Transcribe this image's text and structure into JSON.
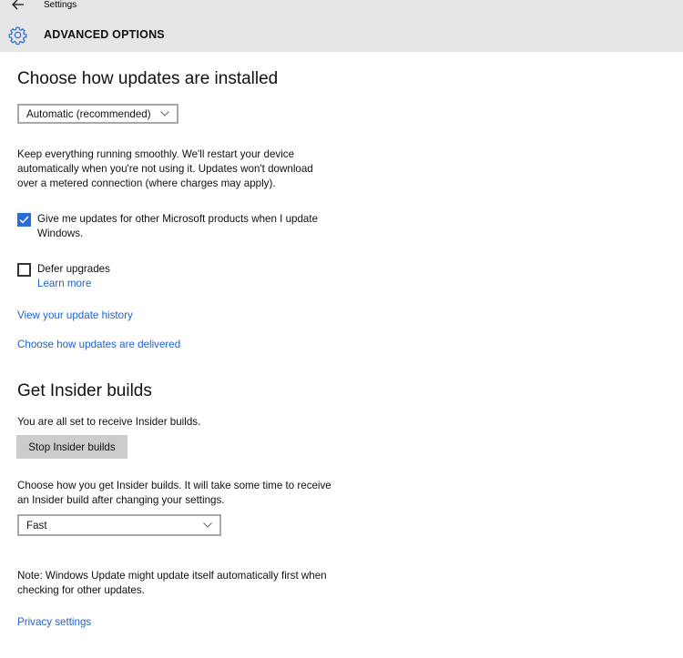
{
  "window": {
    "app_title": "Settings",
    "page_title": "ADVANCED OPTIONS",
    "back_icon": "back-arrow-icon",
    "page_icon": "gear-icon"
  },
  "accent_color": "#2b6bd6",
  "link_color": "#2163c7",
  "install": {
    "heading": "Choose how updates are installed",
    "dropdown_value": "Automatic (recommended)",
    "description_lines": [
      "Keep everything running smoothly. We'll restart your device",
      "automatically when you're not using it. Updates won't download",
      "over a metered connection (where charges may apply)."
    ],
    "ms_products_checkbox": {
      "checked": true,
      "label_lines": [
        "Give me updates for other Microsoft products when I update",
        "Windows."
      ]
    },
    "defer_checkbox": {
      "checked": false,
      "label": "Defer upgrades",
      "learn_more": "Learn more"
    },
    "update_history_link": "View your update history",
    "delivery_link": "Choose how updates are delivered"
  },
  "insider": {
    "heading": "Get Insider builds",
    "status": "You are all set to receive Insider builds.",
    "stop_button": "Stop Insider builds",
    "choose_lines": [
      "Choose how you get Insider builds. It will take some time to receive",
      "an Insider build after changing your settings."
    ],
    "ring_dropdown_value": "Fast"
  },
  "note_lines": [
    "Note: Windows Update might update itself automatically first when",
    "checking for other updates."
  ],
  "privacy_link": "Privacy settings"
}
